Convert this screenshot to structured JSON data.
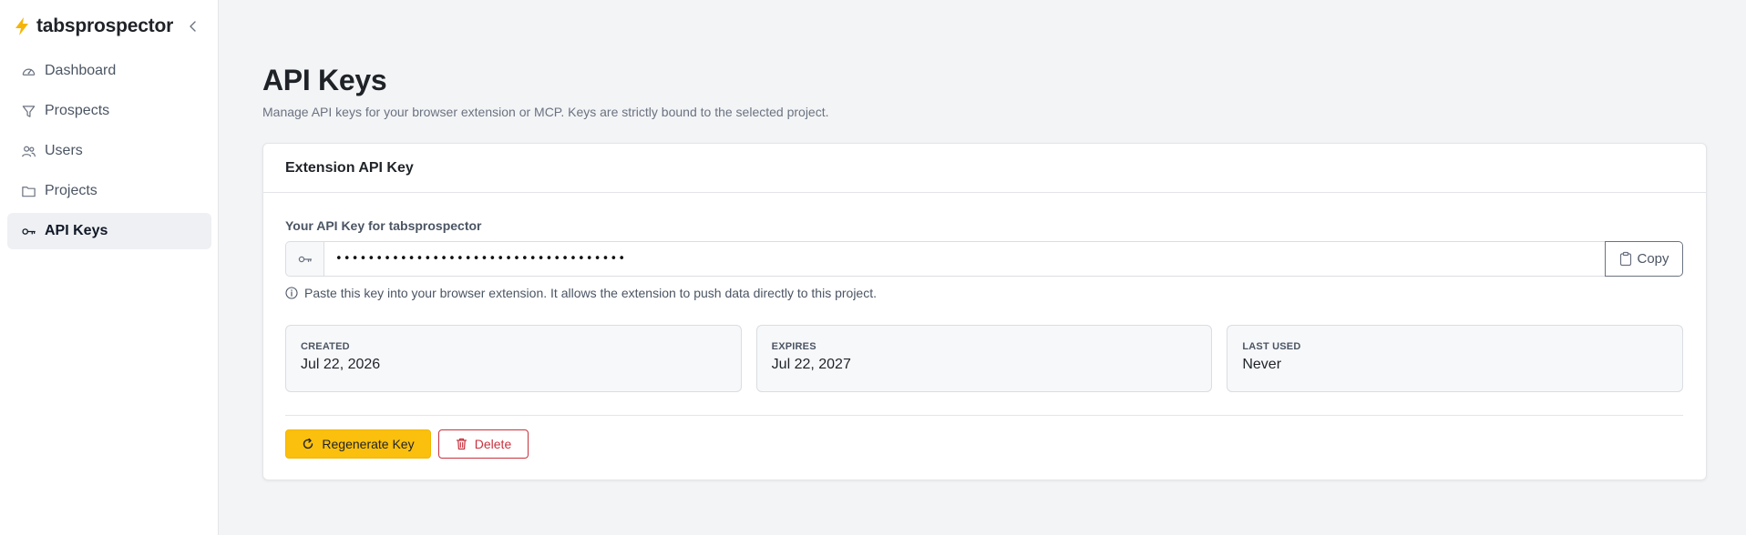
{
  "brand": {
    "name": "tabsprospector",
    "icon": "lightning-bolt-icon",
    "accent": "#f5b60a"
  },
  "sidebar": {
    "items": [
      {
        "label": "Dashboard",
        "icon": "dashboard-gauge-icon",
        "active": false
      },
      {
        "label": "Prospects",
        "icon": "filter-icon",
        "active": false
      },
      {
        "label": "Users",
        "icon": "users-icon",
        "active": false
      },
      {
        "label": "Projects",
        "icon": "folder-icon",
        "active": false
      },
      {
        "label": "API Keys",
        "icon": "key-icon",
        "active": true
      }
    ]
  },
  "page": {
    "title": "API Keys",
    "subtitle": "Manage API keys for your browser extension or MCP. Keys are strictly bound to the selected project."
  },
  "card": {
    "title": "Extension API Key",
    "field_label": "Your API Key for tabsprospector",
    "key_value": "••••••••••••••••••••••••••••••••••••",
    "copy_label": "Copy",
    "hint": "Paste this key into your browser extension. It allows the extension to push data directly to this project.",
    "stats": [
      {
        "label": "CREATED",
        "value": "Jul 22, 2026"
      },
      {
        "label": "EXPIRES",
        "value": "Jul 22, 2027"
      },
      {
        "label": "LAST USED",
        "value": "Never"
      }
    ],
    "regenerate_label": "Regenerate Key",
    "delete_label": "Delete"
  },
  "colors": {
    "regenerate_bg": "#fbbf0d",
    "delete": "#c8323e",
    "active_nav_bg": "#eef0f3"
  }
}
